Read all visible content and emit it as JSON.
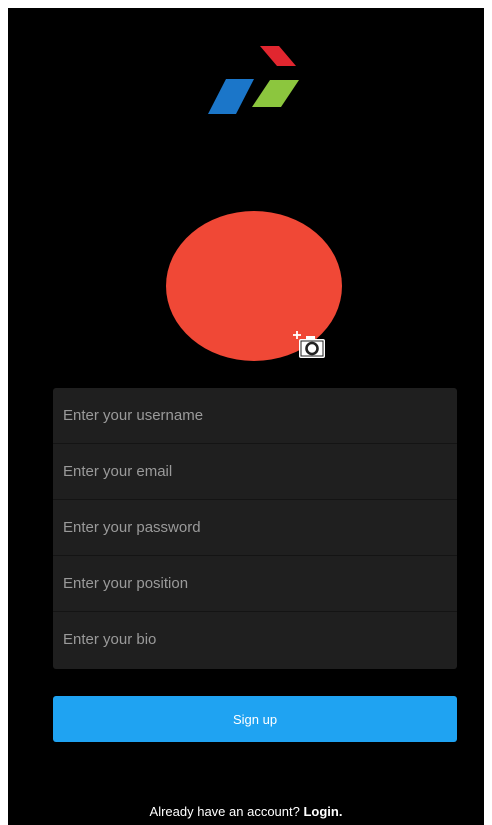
{
  "app": {
    "logo_icon": "brand-logo-icon",
    "colors": {
      "background": "#000000",
      "avatar": "#f04836",
      "form_background": "#1f1f1f",
      "primary_button": "#1fa3f2",
      "logo_red": "#e1262f",
      "logo_blue": "#1b76c9",
      "logo_green": "#8cc63e"
    }
  },
  "profile": {
    "avatar_icon": "avatar-placeholder",
    "add_photo_icon": "add-photo-camera-icon"
  },
  "form": {
    "username_placeholder": "Enter your username",
    "email_placeholder": "Enter your email",
    "password_placeholder": "Enter your password",
    "position_placeholder": "Enter your position",
    "bio_placeholder": "Enter your bio"
  },
  "actions": {
    "signup_label": "Sign up"
  },
  "footer": {
    "prompt_text": "Already have an account? ",
    "login_label": "Login."
  }
}
